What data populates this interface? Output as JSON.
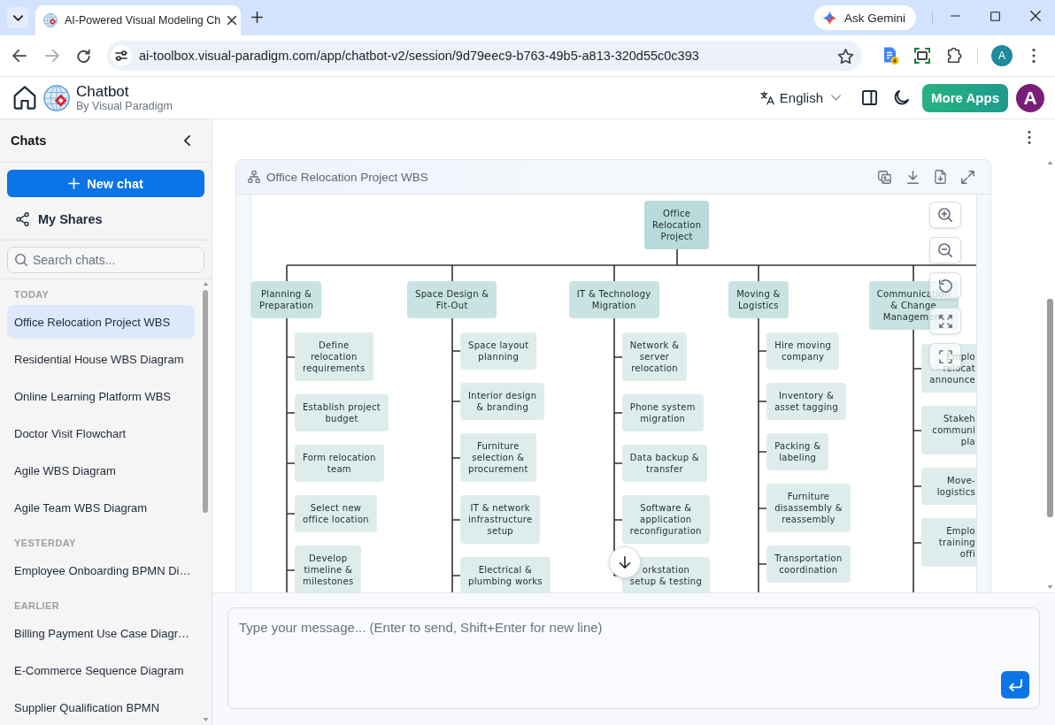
{
  "browser": {
    "tab_title": "AI-Powered Visual Modeling Ch",
    "ask_gemini": "Ask Gemini",
    "url": "ai-toolbox.visual-paradigm.com/app/chatbot-v2/session/9d79eec9-b763-49b5-a813-320d55c0c393",
    "profile_initial": "A"
  },
  "header": {
    "title": "Chatbot",
    "subtitle": "By Visual Paradigm",
    "language": "English",
    "more_apps": "More Apps",
    "avatar_initial": "A"
  },
  "sidebar": {
    "title": "Chats",
    "new_chat": "New chat",
    "my_shares": "My Shares",
    "search": {
      "placeholder": "Search chats..."
    },
    "groups": [
      {
        "label": "TODAY",
        "items": [
          {
            "title": "Office Relocation Project WBS",
            "selected": true
          },
          {
            "title": "Residential House WBS Diagram",
            "selected": false
          },
          {
            "title": "Online Learning Platform WBS",
            "selected": false
          },
          {
            "title": "Doctor Visit Flowchart",
            "selected": false
          },
          {
            "title": "Agile WBS Diagram",
            "selected": false
          },
          {
            "title": "Agile Team WBS Diagram",
            "selected": false
          }
        ]
      },
      {
        "label": "YESTERDAY",
        "items": [
          {
            "title": "Employee Onboarding BPMN Di…",
            "selected": false
          }
        ]
      },
      {
        "label": "EARLIER",
        "items": [
          {
            "title": "Billing Payment Use Case Diagr…",
            "selected": false
          },
          {
            "title": "E-Commerce Sequence Diagram",
            "selected": false
          },
          {
            "title": "Supplier Qualification BPMN",
            "selected": false
          }
        ]
      }
    ]
  },
  "diagram": {
    "title": "Office Relocation Project WBS",
    "tree": {
      "label": "Office\nRelocation\nProject",
      "children": [
        {
          "label": "Planning &\nPreparation",
          "continues": true,
          "children": [
            {
              "label": "Define\nrelocation\nrequirements"
            },
            {
              "label": "Establish project\nbudget"
            },
            {
              "label": "Form relocation\nteam"
            },
            {
              "label": "Select new\noffice location"
            },
            {
              "label": "Develop\ntimeline &\nmilestones"
            }
          ]
        },
        {
          "label": "Space Design &\nFit-Out",
          "continues": true,
          "children": [
            {
              "label": "Space layout\nplanning"
            },
            {
              "label": "Interior design\n& branding"
            },
            {
              "label": "Furniture\nselection &\nprocurement"
            },
            {
              "label": "IT & network\ninfrastructure\nsetup"
            },
            {
              "label": "Electrical &\nplumbing works"
            }
          ]
        },
        {
          "label": "IT & Technology\nMigration",
          "continues": false,
          "children": [
            {
              "label": "Network &\nserver\nrelocation"
            },
            {
              "label": "Phone system\nmigration"
            },
            {
              "label": "Data backup &\ntransfer"
            },
            {
              "label": "Software &\napplication\nreconfiguration"
            },
            {
              "label": "orkstation\nsetup & testing"
            }
          ]
        },
        {
          "label": "Moving &\nLogistics",
          "continues": true,
          "children": [
            {
              "label": "Hire moving\ncompany"
            },
            {
              "label": "Inventory &\nasset tagging"
            },
            {
              "label": "Packing &\nlabeling"
            },
            {
              "label": "Furniture\ndisassembly &\nreassembly"
            },
            {
              "label": "Transportation\ncoordination"
            }
          ]
        },
        {
          "label": "Communication\n& Change\nManagement",
          "continues": true,
          "children": [
            {
              "label": "Emplo\nrelocat\nannounce"
            },
            {
              "label": "Stakeh\ncommuni\npla"
            },
            {
              "label": "Move-\nlogistics"
            },
            {
              "label": "Emplo\ntraining\noffi"
            }
          ]
        }
      ]
    }
  },
  "composer": {
    "placeholder": "Type your message... (Enter to send, Shift+Enter for new line)"
  }
}
